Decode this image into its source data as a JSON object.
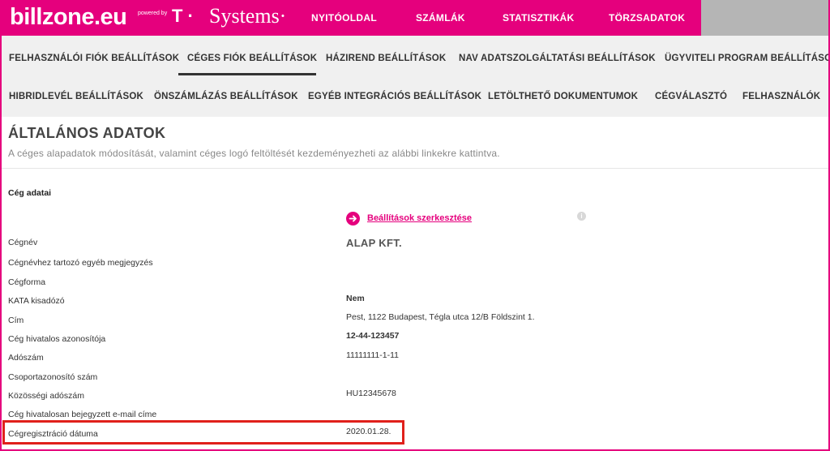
{
  "brand": {
    "logo": "billzone.eu",
    "powered": "powered by",
    "t_mark": "T ·",
    "systems": "Systems·",
    "accent_color": "#e5007d"
  },
  "top_nav": [
    "NYITÓOLDAL",
    "SZÁMLÁK",
    "STATISZTIKÁK",
    "TÖRZSADATOK"
  ],
  "sub_nav": {
    "row1": [
      "FELHASZNÁLÓI FIÓK BEÁLLÍTÁSOK",
      "CÉGES FIÓK BEÁLLÍTÁSOK",
      "HÁZIREND BEÁLLÍTÁSOK",
      "NAV ADATSZOLGÁLTATÁSI BEÁLLÍTÁSOK",
      "ÜGYVITELI PROGRAM BEÁLLÍTÁSOK"
    ],
    "row2": [
      "HIBRIDLEVÉL BEÁLLÍTÁSOK",
      "ÖNSZÁMLÁZÁS BEÁLLÍTÁSOK",
      "EGYÉB INTEGRÁCIÓS BEÁLLÍTÁSOK",
      "LETÖLTHETŐ DOKUMENTUMOK",
      "CÉGVÁLASZTÓ",
      "FELHASZNÁLÓK"
    ],
    "active": "CÉGES FIÓK BEÁLLÍTÁSOK"
  },
  "page": {
    "title": "ÁLTALÁNOS ADATOK",
    "subtitle": "A céges alapadatok módosítását, valamint céges logó feltöltését kezdeményezheti az alábbi linkekre kattintva.",
    "section": "Cég adatai",
    "edit_link": "Beállítások szerkesztése",
    "info_icon": "i"
  },
  "fields": [
    {
      "label": "Cégnév",
      "value": "ALAP KFT."
    },
    {
      "label": "Cégnévhez tartozó egyéb megjegyzés",
      "value": ""
    },
    {
      "label": "Cégforma",
      "value": ""
    },
    {
      "label": "KATA kisadózó",
      "value": "Nem"
    },
    {
      "label": "Cím",
      "value": "Pest, 1122 Budapest, Tégla utca 12/B Földszint 1."
    },
    {
      "label": "Cég hivatalos azonosítója",
      "value": "12-44-123457"
    },
    {
      "label": "Adószám",
      "value": "11111111-1-11"
    },
    {
      "label": "Csoportazonosító szám",
      "value": ""
    },
    {
      "label": "Közösségi adószám",
      "value": "HU12345678"
    },
    {
      "label": "Cég hivatalosan bejegyzett e-mail címe",
      "value": ""
    },
    {
      "label": "Cégregisztráció dátuma",
      "value": "2020.01.28."
    }
  ]
}
